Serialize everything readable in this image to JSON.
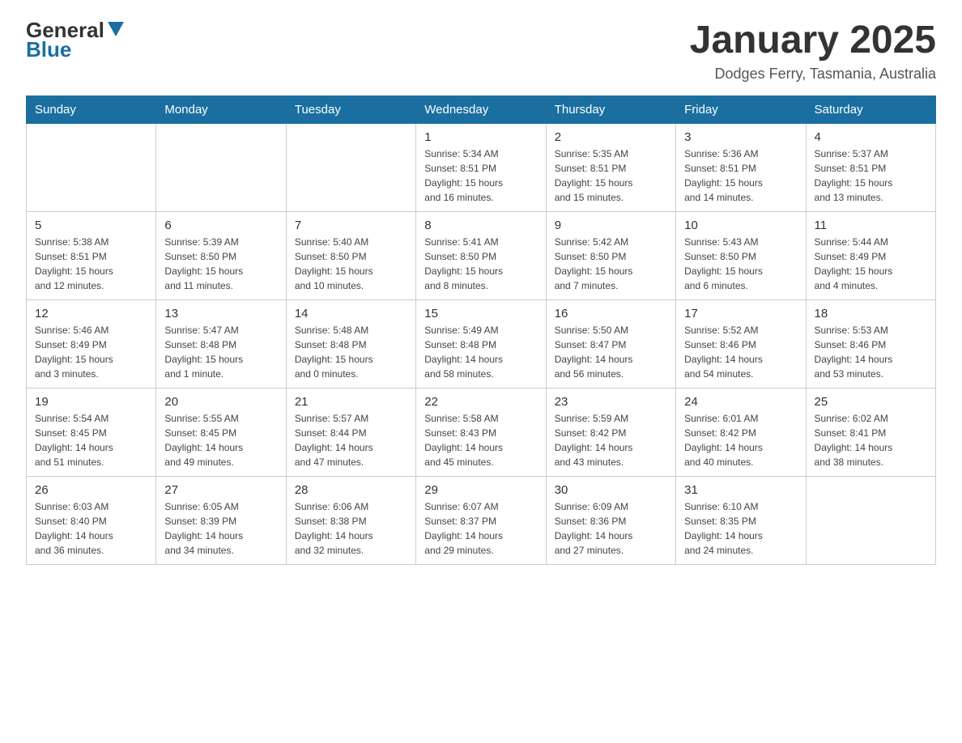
{
  "logo": {
    "general": "General",
    "triangle": "▶",
    "blue": "Blue"
  },
  "title": "January 2025",
  "location": "Dodges Ferry, Tasmania, Australia",
  "weekdays": [
    "Sunday",
    "Monday",
    "Tuesday",
    "Wednesday",
    "Thursday",
    "Friday",
    "Saturday"
  ],
  "weeks": [
    [
      {
        "day": "",
        "detail": ""
      },
      {
        "day": "",
        "detail": ""
      },
      {
        "day": "",
        "detail": ""
      },
      {
        "day": "1",
        "detail": "Sunrise: 5:34 AM\nSunset: 8:51 PM\nDaylight: 15 hours\nand 16 minutes."
      },
      {
        "day": "2",
        "detail": "Sunrise: 5:35 AM\nSunset: 8:51 PM\nDaylight: 15 hours\nand 15 minutes."
      },
      {
        "day": "3",
        "detail": "Sunrise: 5:36 AM\nSunset: 8:51 PM\nDaylight: 15 hours\nand 14 minutes."
      },
      {
        "day": "4",
        "detail": "Sunrise: 5:37 AM\nSunset: 8:51 PM\nDaylight: 15 hours\nand 13 minutes."
      }
    ],
    [
      {
        "day": "5",
        "detail": "Sunrise: 5:38 AM\nSunset: 8:51 PM\nDaylight: 15 hours\nand 12 minutes."
      },
      {
        "day": "6",
        "detail": "Sunrise: 5:39 AM\nSunset: 8:50 PM\nDaylight: 15 hours\nand 11 minutes."
      },
      {
        "day": "7",
        "detail": "Sunrise: 5:40 AM\nSunset: 8:50 PM\nDaylight: 15 hours\nand 10 minutes."
      },
      {
        "day": "8",
        "detail": "Sunrise: 5:41 AM\nSunset: 8:50 PM\nDaylight: 15 hours\nand 8 minutes."
      },
      {
        "day": "9",
        "detail": "Sunrise: 5:42 AM\nSunset: 8:50 PM\nDaylight: 15 hours\nand 7 minutes."
      },
      {
        "day": "10",
        "detail": "Sunrise: 5:43 AM\nSunset: 8:50 PM\nDaylight: 15 hours\nand 6 minutes."
      },
      {
        "day": "11",
        "detail": "Sunrise: 5:44 AM\nSunset: 8:49 PM\nDaylight: 15 hours\nand 4 minutes."
      }
    ],
    [
      {
        "day": "12",
        "detail": "Sunrise: 5:46 AM\nSunset: 8:49 PM\nDaylight: 15 hours\nand 3 minutes."
      },
      {
        "day": "13",
        "detail": "Sunrise: 5:47 AM\nSunset: 8:48 PM\nDaylight: 15 hours\nand 1 minute."
      },
      {
        "day": "14",
        "detail": "Sunrise: 5:48 AM\nSunset: 8:48 PM\nDaylight: 15 hours\nand 0 minutes."
      },
      {
        "day": "15",
        "detail": "Sunrise: 5:49 AM\nSunset: 8:48 PM\nDaylight: 14 hours\nand 58 minutes."
      },
      {
        "day": "16",
        "detail": "Sunrise: 5:50 AM\nSunset: 8:47 PM\nDaylight: 14 hours\nand 56 minutes."
      },
      {
        "day": "17",
        "detail": "Sunrise: 5:52 AM\nSunset: 8:46 PM\nDaylight: 14 hours\nand 54 minutes."
      },
      {
        "day": "18",
        "detail": "Sunrise: 5:53 AM\nSunset: 8:46 PM\nDaylight: 14 hours\nand 53 minutes."
      }
    ],
    [
      {
        "day": "19",
        "detail": "Sunrise: 5:54 AM\nSunset: 8:45 PM\nDaylight: 14 hours\nand 51 minutes."
      },
      {
        "day": "20",
        "detail": "Sunrise: 5:55 AM\nSunset: 8:45 PM\nDaylight: 14 hours\nand 49 minutes."
      },
      {
        "day": "21",
        "detail": "Sunrise: 5:57 AM\nSunset: 8:44 PM\nDaylight: 14 hours\nand 47 minutes."
      },
      {
        "day": "22",
        "detail": "Sunrise: 5:58 AM\nSunset: 8:43 PM\nDaylight: 14 hours\nand 45 minutes."
      },
      {
        "day": "23",
        "detail": "Sunrise: 5:59 AM\nSunset: 8:42 PM\nDaylight: 14 hours\nand 43 minutes."
      },
      {
        "day": "24",
        "detail": "Sunrise: 6:01 AM\nSunset: 8:42 PM\nDaylight: 14 hours\nand 40 minutes."
      },
      {
        "day": "25",
        "detail": "Sunrise: 6:02 AM\nSunset: 8:41 PM\nDaylight: 14 hours\nand 38 minutes."
      }
    ],
    [
      {
        "day": "26",
        "detail": "Sunrise: 6:03 AM\nSunset: 8:40 PM\nDaylight: 14 hours\nand 36 minutes."
      },
      {
        "day": "27",
        "detail": "Sunrise: 6:05 AM\nSunset: 8:39 PM\nDaylight: 14 hours\nand 34 minutes."
      },
      {
        "day": "28",
        "detail": "Sunrise: 6:06 AM\nSunset: 8:38 PM\nDaylight: 14 hours\nand 32 minutes."
      },
      {
        "day": "29",
        "detail": "Sunrise: 6:07 AM\nSunset: 8:37 PM\nDaylight: 14 hours\nand 29 minutes."
      },
      {
        "day": "30",
        "detail": "Sunrise: 6:09 AM\nSunset: 8:36 PM\nDaylight: 14 hours\nand 27 minutes."
      },
      {
        "day": "31",
        "detail": "Sunrise: 6:10 AM\nSunset: 8:35 PM\nDaylight: 14 hours\nand 24 minutes."
      },
      {
        "day": "",
        "detail": ""
      }
    ]
  ]
}
